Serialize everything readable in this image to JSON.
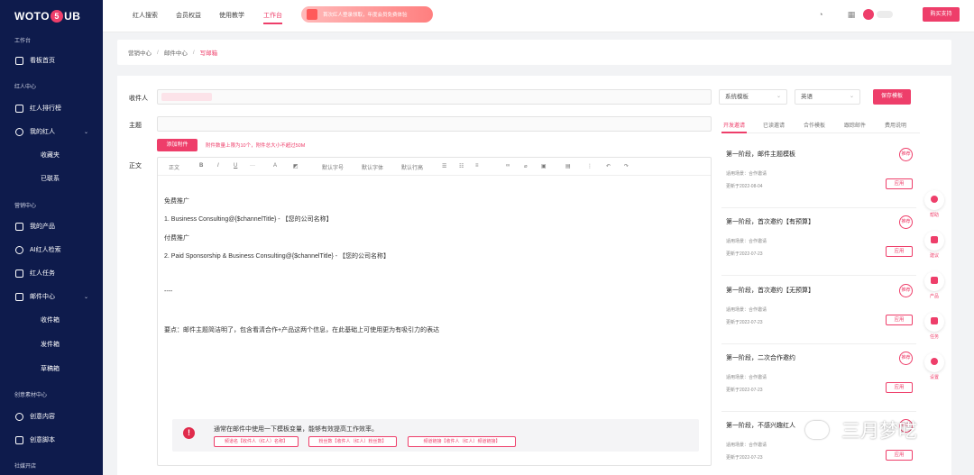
{
  "brand": {
    "logo_text_left": "WOTO",
    "logo_badge": "5",
    "logo_text_right": "UB"
  },
  "sidebar": {
    "group_workspace": "工作台",
    "item_dashboard": "看板首页",
    "group_influencer": "红人中心",
    "item_ranking": "红人排行榜",
    "item_my_influencer": "我的红人",
    "sub_favorites": "收藏夹",
    "sub_contacted": "已联系",
    "group_marketing": "营销中心",
    "item_my_products": "我的产品",
    "item_ai_search": "AI红人检索",
    "item_tasks": "红人任务",
    "item_mail": "邮件中心",
    "sub_inbox": "收件箱",
    "sub_sent": "发件箱",
    "sub_drafts": "草稿箱",
    "group_creative": "创意素材中心",
    "item_creative_content": "创意内容",
    "item_creative_script": "创意脚本",
    "group_community": "社媒开店"
  },
  "topbar": {
    "nav": [
      "红人搜索",
      "会员权益",
      "使用教学",
      "工作台"
    ],
    "active_index": 3,
    "promo_text": "首次红人登录领取，年度会员免费体验",
    "buy_label": "购买支持"
  },
  "breadcrumb": {
    "items": [
      "营销中心",
      "邮件中心",
      "写邮箱"
    ],
    "separator": "/"
  },
  "compose": {
    "recipient_label": "收件人",
    "subject_label": "主题",
    "attach_label": "添加附件",
    "attach_note": "附件数量上限为10个，附件总大小不超过50M",
    "body_label": "正文",
    "toolbar": {
      "paragraph": "正文",
      "bold": "B",
      "italic": "I",
      "underline": "U",
      "more": "···",
      "color": "A",
      "font_size": "默认字号",
      "font_family": "默认字体",
      "line_height": "默认行高"
    },
    "body_lines": [
      "免费推广",
      "1. Business Consulting@{$channelTitle} - 【您的公司名称】",
      "付费推广",
      "2. Paid Sponsorship & Business Consulting@{$channelTitle} - 【您的公司名称】",
      "----",
      "要点：邮件主题简洁明了，包含看清合作+产品这两个信息，在此基础上可使用更为有吸引力的表达"
    ],
    "tip_icon": "!",
    "tip_text": "通常在邮件中使用一下模板变量，能够有效提高工作效率。",
    "tip_buttons": [
      "频道名【收件人（红人）名称】",
      "粉丝数【收件人（红人）粉丝数】",
      "频道链接【收件人（红人）频道链接】"
    ]
  },
  "right_panel": {
    "template_select": "系统模板",
    "language_select": "英语",
    "generate_label": "保存模板",
    "tabs": [
      "开发邀请",
      "已读邀请",
      "合作模板",
      "跟踪邮件",
      "费用说明"
    ],
    "active_tab": 0,
    "templates": [
      {
        "title": "第一阶段，邮件主题模板",
        "badge": "推荐",
        "scene": "适用场景：合作邀请",
        "date": "更新于2022-08-04",
        "use": "应用"
      },
      {
        "title": "第一阶段，首次邀约【有预算】",
        "badge": "推荐",
        "scene": "适用场景：合作邀请",
        "date": "更新于2022-07-23",
        "use": "应用"
      },
      {
        "title": "第一阶段，首次邀约【无预算】",
        "badge": "推荐",
        "scene": "适用场景：合作邀请",
        "date": "更新于2022-07-23",
        "use": "应用"
      },
      {
        "title": "第一阶段，二次合作邀约",
        "badge": "推荐",
        "scene": "适用场景：合作邀请",
        "date": "更新于2022-07-23",
        "use": "应用"
      },
      {
        "title": "第一阶段，不感兴趣红人",
        "badge": "推荐",
        "scene": "适用场景：合作邀请",
        "date": "更新于2022-07-23",
        "use": "应用"
      }
    ]
  },
  "float_tools": [
    "帮助",
    "建议",
    "产品",
    "任务",
    "设置"
  ],
  "watermark": "三月梦呓",
  "colors": {
    "accent": "#ee3e6a",
    "sidebar": "#0e1b4c"
  }
}
